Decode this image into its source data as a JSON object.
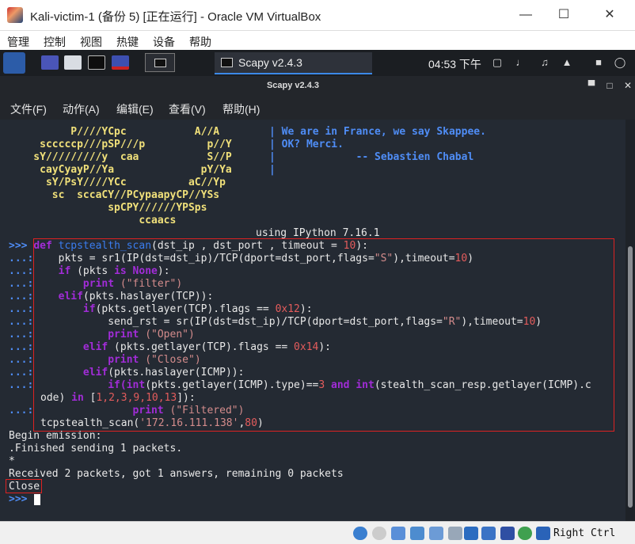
{
  "host": {
    "title": "Kali-victim-1 (备份 5) [正在运行] - Oracle VM VirtualBox",
    "menu": [
      "管理",
      "控制",
      "视图",
      "热键",
      "设备",
      "帮助"
    ],
    "host_key": "Right Ctrl"
  },
  "guest_panel": {
    "active_task": "Scapy v2.4.3",
    "clock": "04:53 下午"
  },
  "terminal": {
    "title": "Scapy v2.4.3",
    "menu": [
      "文件(F)",
      "动作(A)",
      "编辑(E)",
      "查看(V)",
      "帮助(H)"
    ],
    "banner": [
      "          P////YCpc           A//A",
      "     scccccp///pSP///p          p//Y",
      "    sY/////////y  caa           S//P",
      "     cayCyayP//Ya              pY/Ya",
      "      sY/PsY////YCc          aC//Yp",
      "       sc  sccaCY//PCypaapyCP//YSs",
      "                spCPY//////YPSps",
      "                     ccaacs"
    ],
    "quote": [
      "| We are in France, we say Skappee.",
      "| OK? Merci.",
      "|             -- Sebastien Chabal",
      "|"
    ],
    "ipython_line": "using IPython 7.16.1",
    "prompt": ">>>",
    "continuation": "...:",
    "code": {
      "l1_def": "def ",
      "l1_fn": "tcpstealth_scan",
      "l1_args": "(dst_ip , dst_port , timeout = ",
      "l1_num": "10",
      "l1_end": "):",
      "l2_a": "    pkts = sr1(IP(dst=dst_ip)/TCP(dport=dst_port,flags=",
      "l2_str": "\"S\"",
      "l2_b": "),timeout=",
      "l2_num": "10",
      "l2_c": ")",
      "l3_if": "    if",
      " l3_a": "",
      "l3_a2": " (pkts ",
      "l3_is": "is None",
      "l3_b": "):",
      "l4_print": "        print",
      "l4_str": " (\"filter\")",
      "l5_elif": "    elif",
      "l5_a": "(pkts.haslayer(TCP)):",
      "l6_if": "        if",
      "l6_a": "(pkts.getlayer(TCP).flags ",
      "l6_op": "==",
      "l6_num": " 0x12",
      "l6_b": "):",
      "l7": "            send_rst = sr(IP(dst=dst_ip)/TCP(dport=dst_port,flags=",
      "l7_str": "\"R\"",
      "l7_b": "),timeout=",
      "l7_num": "10",
      "l7_c": ")",
      "l8_print": "            print",
      "l8_str": " (\"Open\")",
      "l9_elif": "        elif",
      "l9_a": " (pkts.getlayer(TCP).flags ",
      "l9_op": "==",
      "l9_num": " 0x14",
      "l9_b": "):",
      "l10_print": "            print",
      "l10_str": " (\"Close\")",
      "l11_elif": "        elif",
      "l11_a": "(pkts.haslayer(ICMP)):",
      "l12_if": "            if",
      "l12_int": "(int",
      "l12_a": "(pkts.getlayer(ICMP).type)",
      "l12_op": "==",
      "l12_num": "3",
      "l12_and": " and ",
      "l12_int2": "int",
      "l12_b": "(stealth_scan_resp.getlayer(ICMP).c",
      "l13_a": "ode) ",
      "l13_in": "in",
      "l13_b": " [",
      "l13_nums": "1,2,3,9,10,13",
      "l13_c": "]):",
      "l14_print": "                print",
      "l14_str": " (\"Filtered\")",
      "l15_a": "tcpstealth_scan(",
      "l15_str": "'172.16.111.138'",
      "l15_b": ",",
      "l15_num": "80",
      "l15_c": ")"
    },
    "output": [
      "Begin emission:",
      ".Finished sending 1 packets.",
      "*",
      "Received 2 packets, got 1 answers, remaining 0 packets",
      "Close"
    ]
  }
}
